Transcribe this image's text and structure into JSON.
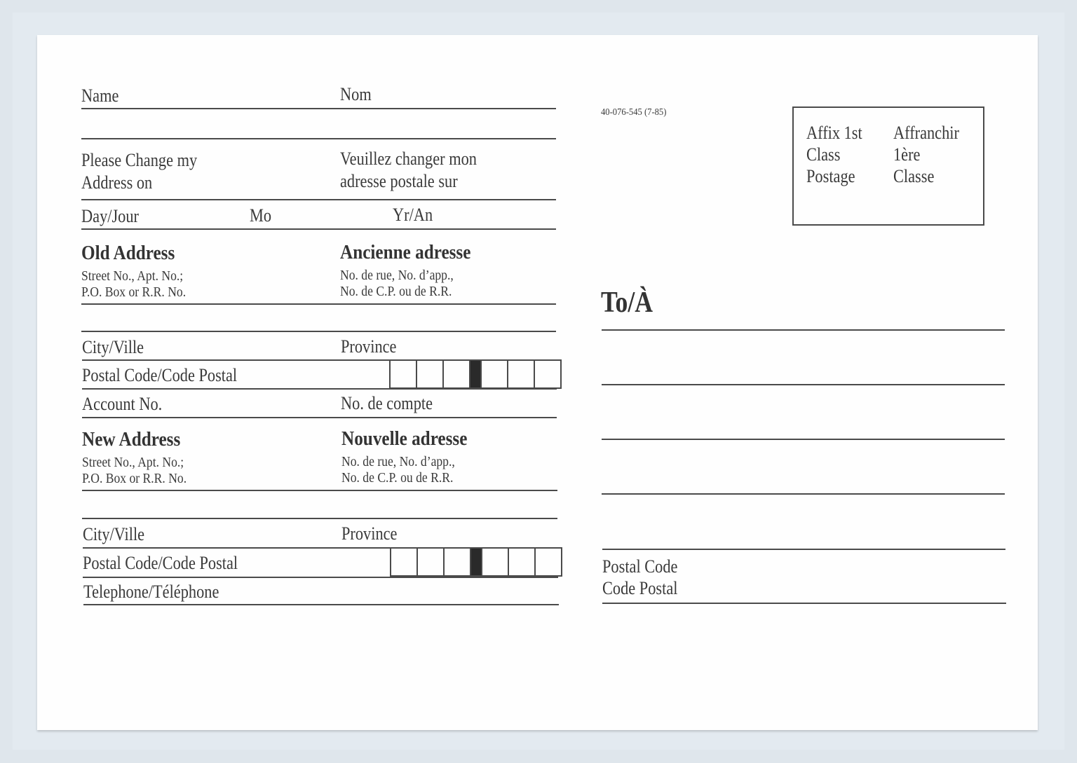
{
  "form": {
    "name_en": "Name",
    "name_fr": "Nom",
    "change_en_1": "Please Change my",
    "change_en_2": "Address on",
    "change_fr_1": "Veuillez changer mon",
    "change_fr_2": "adresse postale sur",
    "day": "Day/Jour",
    "month": "Mo",
    "year": "Yr/An",
    "old_address": {
      "title_en": "Old Address",
      "title_fr": "Ancienne adresse",
      "sub_en_1": "Street No., Apt. No.;",
      "sub_en_2": "P.O. Box or R.R. No.",
      "sub_fr_1": "No. de rue, No. d’app.,",
      "sub_fr_2": "No. de C.P. ou de R.R.",
      "city": "City/Ville",
      "province": "Province",
      "postal_code": "Postal Code/Code Postal"
    },
    "account_en": "Account No.",
    "account_fr": "No. de compte",
    "new_address": {
      "title_en": "New Address",
      "title_fr": "Nouvelle adresse",
      "sub_en_1": "Street No., Apt. No.;",
      "sub_en_2": "P.O. Box or R.R. No.",
      "sub_fr_1": "No. de rue, No. d’app.,",
      "sub_fr_2": "No. de C.P. ou de R.R.",
      "city": "City/Ville",
      "province": "Province",
      "postal_code": "Postal Code/Code Postal"
    },
    "telephone": "Telephone/Téléphone"
  },
  "address_side": {
    "form_code": "40-076-545 (7-85)",
    "stamp": {
      "en_1": "Affix 1st",
      "en_2": "Class",
      "en_3": "Postage",
      "fr_1": "Affranchir",
      "fr_2": "1ère",
      "fr_3": "Classe"
    },
    "to": "To/À",
    "postal_code_en": "Postal Code",
    "postal_code_fr": "Code Postal"
  }
}
